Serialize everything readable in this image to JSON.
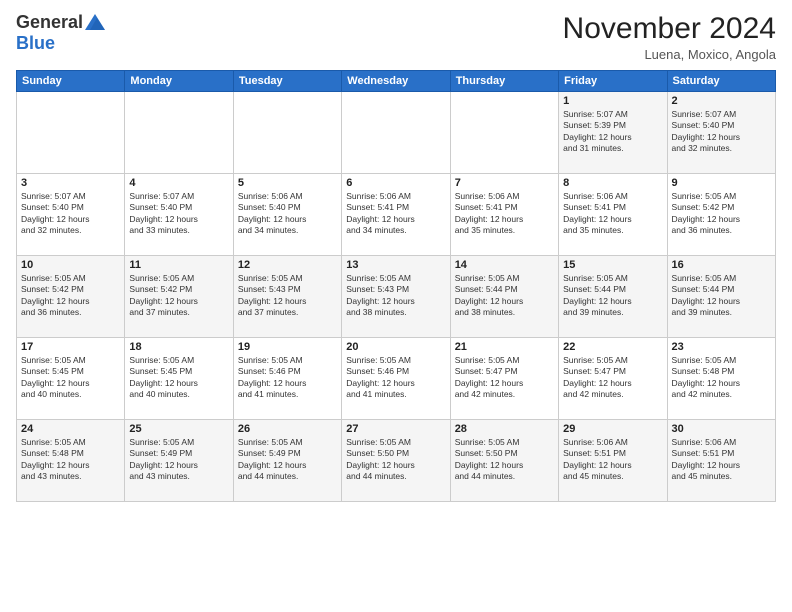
{
  "header": {
    "logo_general": "General",
    "logo_blue": "Blue",
    "month_title": "November 2024",
    "location": "Luena, Moxico, Angola"
  },
  "days_of_week": [
    "Sunday",
    "Monday",
    "Tuesday",
    "Wednesday",
    "Thursday",
    "Friday",
    "Saturday"
  ],
  "weeks": [
    [
      {
        "day": "",
        "info": ""
      },
      {
        "day": "",
        "info": ""
      },
      {
        "day": "",
        "info": ""
      },
      {
        "day": "",
        "info": ""
      },
      {
        "day": "",
        "info": ""
      },
      {
        "day": "1",
        "info": "Sunrise: 5:07 AM\nSunset: 5:39 PM\nDaylight: 12 hours\nand 31 minutes."
      },
      {
        "day": "2",
        "info": "Sunrise: 5:07 AM\nSunset: 5:40 PM\nDaylight: 12 hours\nand 32 minutes."
      }
    ],
    [
      {
        "day": "3",
        "info": "Sunrise: 5:07 AM\nSunset: 5:40 PM\nDaylight: 12 hours\nand 32 minutes."
      },
      {
        "day": "4",
        "info": "Sunrise: 5:07 AM\nSunset: 5:40 PM\nDaylight: 12 hours\nand 33 minutes."
      },
      {
        "day": "5",
        "info": "Sunrise: 5:06 AM\nSunset: 5:40 PM\nDaylight: 12 hours\nand 34 minutes."
      },
      {
        "day": "6",
        "info": "Sunrise: 5:06 AM\nSunset: 5:41 PM\nDaylight: 12 hours\nand 34 minutes."
      },
      {
        "day": "7",
        "info": "Sunrise: 5:06 AM\nSunset: 5:41 PM\nDaylight: 12 hours\nand 35 minutes."
      },
      {
        "day": "8",
        "info": "Sunrise: 5:06 AM\nSunset: 5:41 PM\nDaylight: 12 hours\nand 35 minutes."
      },
      {
        "day": "9",
        "info": "Sunrise: 5:05 AM\nSunset: 5:42 PM\nDaylight: 12 hours\nand 36 minutes."
      }
    ],
    [
      {
        "day": "10",
        "info": "Sunrise: 5:05 AM\nSunset: 5:42 PM\nDaylight: 12 hours\nand 36 minutes."
      },
      {
        "day": "11",
        "info": "Sunrise: 5:05 AM\nSunset: 5:42 PM\nDaylight: 12 hours\nand 37 minutes."
      },
      {
        "day": "12",
        "info": "Sunrise: 5:05 AM\nSunset: 5:43 PM\nDaylight: 12 hours\nand 37 minutes."
      },
      {
        "day": "13",
        "info": "Sunrise: 5:05 AM\nSunset: 5:43 PM\nDaylight: 12 hours\nand 38 minutes."
      },
      {
        "day": "14",
        "info": "Sunrise: 5:05 AM\nSunset: 5:44 PM\nDaylight: 12 hours\nand 38 minutes."
      },
      {
        "day": "15",
        "info": "Sunrise: 5:05 AM\nSunset: 5:44 PM\nDaylight: 12 hours\nand 39 minutes."
      },
      {
        "day": "16",
        "info": "Sunrise: 5:05 AM\nSunset: 5:44 PM\nDaylight: 12 hours\nand 39 minutes."
      }
    ],
    [
      {
        "day": "17",
        "info": "Sunrise: 5:05 AM\nSunset: 5:45 PM\nDaylight: 12 hours\nand 40 minutes."
      },
      {
        "day": "18",
        "info": "Sunrise: 5:05 AM\nSunset: 5:45 PM\nDaylight: 12 hours\nand 40 minutes."
      },
      {
        "day": "19",
        "info": "Sunrise: 5:05 AM\nSunset: 5:46 PM\nDaylight: 12 hours\nand 41 minutes."
      },
      {
        "day": "20",
        "info": "Sunrise: 5:05 AM\nSunset: 5:46 PM\nDaylight: 12 hours\nand 41 minutes."
      },
      {
        "day": "21",
        "info": "Sunrise: 5:05 AM\nSunset: 5:47 PM\nDaylight: 12 hours\nand 42 minutes."
      },
      {
        "day": "22",
        "info": "Sunrise: 5:05 AM\nSunset: 5:47 PM\nDaylight: 12 hours\nand 42 minutes."
      },
      {
        "day": "23",
        "info": "Sunrise: 5:05 AM\nSunset: 5:48 PM\nDaylight: 12 hours\nand 42 minutes."
      }
    ],
    [
      {
        "day": "24",
        "info": "Sunrise: 5:05 AM\nSunset: 5:48 PM\nDaylight: 12 hours\nand 43 minutes."
      },
      {
        "day": "25",
        "info": "Sunrise: 5:05 AM\nSunset: 5:49 PM\nDaylight: 12 hours\nand 43 minutes."
      },
      {
        "day": "26",
        "info": "Sunrise: 5:05 AM\nSunset: 5:49 PM\nDaylight: 12 hours\nand 44 minutes."
      },
      {
        "day": "27",
        "info": "Sunrise: 5:05 AM\nSunset: 5:50 PM\nDaylight: 12 hours\nand 44 minutes."
      },
      {
        "day": "28",
        "info": "Sunrise: 5:05 AM\nSunset: 5:50 PM\nDaylight: 12 hours\nand 44 minutes."
      },
      {
        "day": "29",
        "info": "Sunrise: 5:06 AM\nSunset: 5:51 PM\nDaylight: 12 hours\nand 45 minutes."
      },
      {
        "day": "30",
        "info": "Sunrise: 5:06 AM\nSunset: 5:51 PM\nDaylight: 12 hours\nand 45 minutes."
      }
    ]
  ]
}
